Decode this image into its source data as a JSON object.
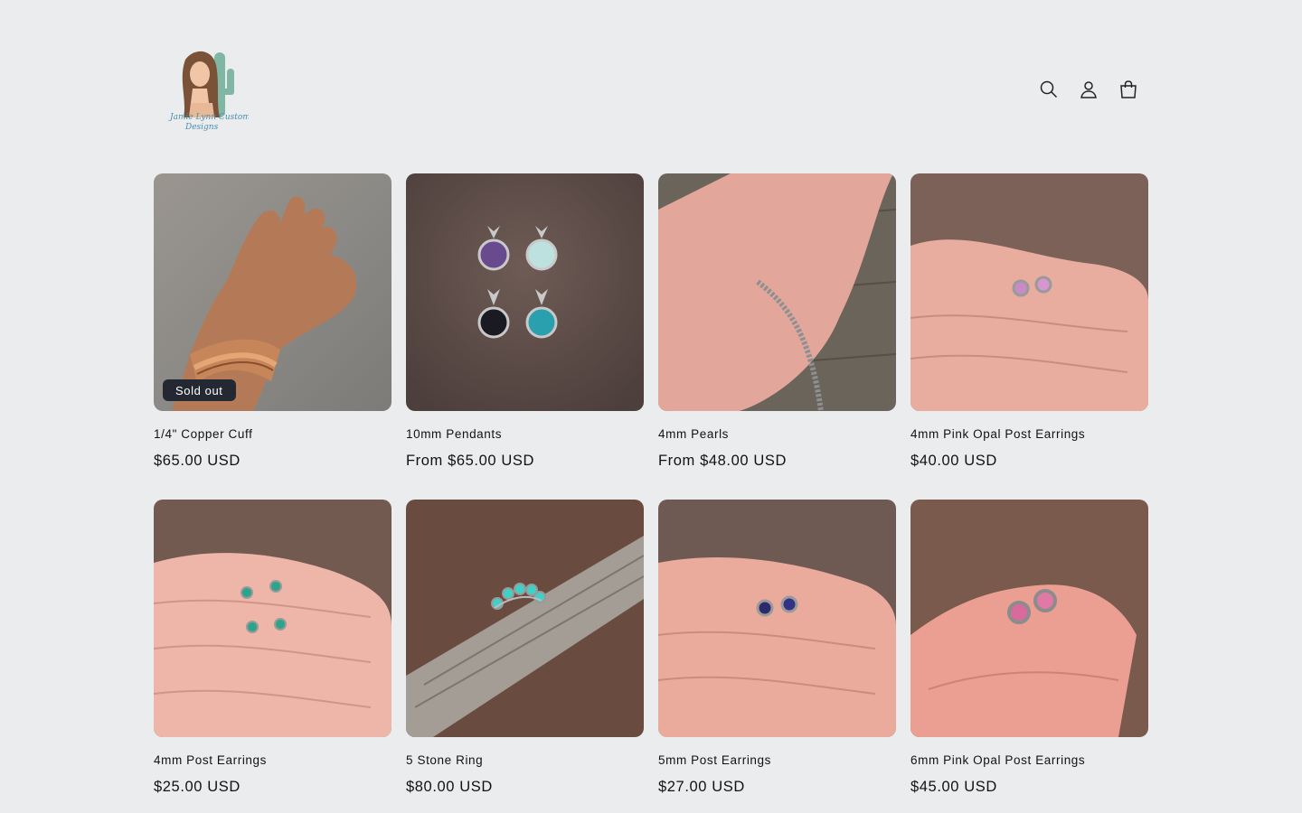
{
  "header": {
    "logo_alt": "Jamie Lynn Custom Designs",
    "icons": [
      "search-icon",
      "account-icon",
      "cart-icon"
    ]
  },
  "products": [
    {
      "title": "1/4\" Copper Cuff",
      "price": "$65.00 USD",
      "badge": "Sold out",
      "image": "copper-cuff-on-wrist"
    },
    {
      "title": "10mm Pendants",
      "price": "From $65.00 USD",
      "badge": "",
      "image": "four-stone-pendants"
    },
    {
      "title": "4mm Pearls",
      "price": "From $48.00 USD",
      "badge": "",
      "image": "pearl-necklace-on-palm"
    },
    {
      "title": "4mm Pink Opal Post Earrings",
      "price": "$40.00 USD",
      "badge": "",
      "image": "pink-opal-studs-on-fingers"
    },
    {
      "title": "4mm Post Earrings",
      "price": "$25.00 USD",
      "badge": "",
      "image": "turquoise-studs-on-fingers"
    },
    {
      "title": "5 Stone Ring",
      "price": "$80.00 USD",
      "badge": "",
      "image": "five-stone-ring-on-wood"
    },
    {
      "title": "5mm Post Earrings",
      "price": "$27.00 USD",
      "badge": "",
      "image": "blue-studs-on-fingers"
    },
    {
      "title": "6mm Pink Opal Post Earrings",
      "price": "$45.00 USD",
      "badge": "",
      "image": "large-pink-opal-studs"
    }
  ],
  "colors": {
    "background": "#ebecee",
    "badge": "#242833",
    "text": "#121212"
  }
}
